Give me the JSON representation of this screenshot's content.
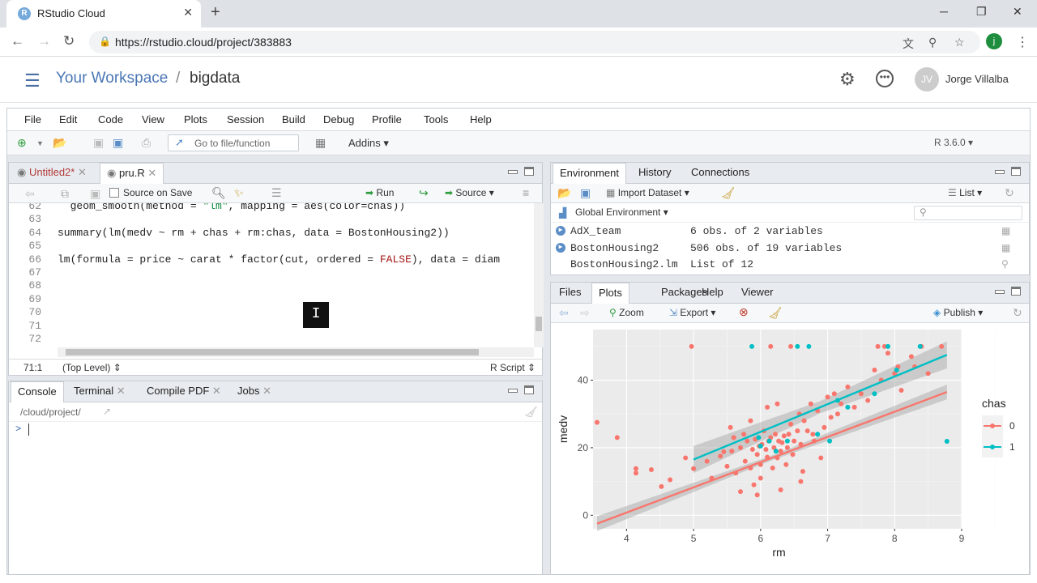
{
  "browser": {
    "tab_title": "RStudio Cloud",
    "tab_favicon": "R",
    "url": "https://rstudio.cloud/project/383883",
    "profile_initial": "j"
  },
  "header": {
    "workspace": "Your Workspace",
    "separator": "/",
    "project": "bigdata",
    "avatar_initials": "JV",
    "username": "Jorge Villalba"
  },
  "menubar": [
    "File",
    "Edit",
    "Code",
    "View",
    "Plots",
    "Session",
    "Build",
    "Debug",
    "Profile",
    "Tools",
    "Help"
  ],
  "toolbar": {
    "goto_placeholder": "Go to file/function",
    "addins": "Addins",
    "r_version": "R 3.6.0"
  },
  "editor": {
    "tabs": [
      "Untitled2*",
      "pru.R"
    ],
    "source_on_save": "Source on Save",
    "run": "Run",
    "source": "Source",
    "lines": [
      {
        "n": "62",
        "code": "  geom_smooth(method = \"lm\", mapping = aes(color=chas))"
      },
      {
        "n": "63",
        "code": ""
      },
      {
        "n": "64",
        "code": "summary(lm(medv ~ rm + chas + rm:chas, data = BostonHousing2))"
      },
      {
        "n": "65",
        "code": ""
      },
      {
        "n": "66",
        "code": "lm(formula = price ~ carat * factor(cut, ordered = FALSE), data = diam"
      },
      {
        "n": "67",
        "code": ""
      },
      {
        "n": "68",
        "code": ""
      },
      {
        "n": "69",
        "code": ""
      },
      {
        "n": "70",
        "code": ""
      },
      {
        "n": "71",
        "code": ""
      },
      {
        "n": "72",
        "code": ""
      }
    ],
    "status_pos": "71:1",
    "status_scope": "(Top Level)",
    "status_type": "R Script"
  },
  "console": {
    "tabs": [
      "Console",
      "Terminal",
      "Compile PDF",
      "Jobs"
    ],
    "path": "/cloud/project/",
    "prompt": ">"
  },
  "environment": {
    "tabs": [
      "Environment",
      "History",
      "Connections"
    ],
    "import_dataset": "Import Dataset",
    "list_label": "List",
    "scope": "Global Environment",
    "rows": [
      {
        "name": "AdX_team",
        "value": "6 obs. of 2 variables"
      },
      {
        "name": "BostonHousing2",
        "value": "506 obs. of 19 variables"
      },
      {
        "name": "BostonHousing2.lm",
        "value": "List of 12"
      }
    ]
  },
  "plots": {
    "tabs": [
      "Files",
      "Plots",
      "Packages",
      "Help",
      "Viewer"
    ],
    "zoom": "Zoom",
    "export": "Export",
    "publish": "Publish"
  },
  "chart_data": {
    "type": "scatter",
    "title": "",
    "xlabel": "rm",
    "ylabel": "medv",
    "xlim": [
      3.5,
      9
    ],
    "ylim": [
      -4,
      55
    ],
    "xticks": [
      "4",
      "5",
      "6",
      "7",
      "8",
      "9"
    ],
    "yticks": [
      "0",
      "20",
      "40"
    ],
    "legend_title": "chas",
    "legend_position": "right",
    "series": [
      {
        "name": "0",
        "color": "#f8766d",
        "points": [
          [
            3.56,
            27.5
          ],
          [
            3.86,
            23
          ],
          [
            4.14,
            13.8
          ],
          [
            4.14,
            12.5
          ],
          [
            4.37,
            13.5
          ],
          [
            4.52,
            8.5
          ],
          [
            4.65,
            10.5
          ],
          [
            4.88,
            17
          ],
          [
            4.97,
            50
          ],
          [
            5.0,
            13.8
          ],
          [
            5.2,
            16
          ],
          [
            5.27,
            11
          ],
          [
            5.4,
            17.5
          ],
          [
            5.45,
            18.8
          ],
          [
            5.5,
            14.5
          ],
          [
            5.57,
            19
          ],
          [
            5.6,
            23
          ],
          [
            5.63,
            12.5
          ],
          [
            5.7,
            20
          ],
          [
            5.75,
            24
          ],
          [
            5.77,
            16
          ],
          [
            5.8,
            22
          ],
          [
            5.85,
            14
          ],
          [
            5.88,
            19.5
          ],
          [
            5.9,
            9
          ],
          [
            5.92,
            22.5
          ],
          [
            5.95,
            18
          ],
          [
            5.98,
            20.5
          ],
          [
            6.0,
            15
          ],
          [
            6.02,
            21
          ],
          [
            6.05,
            25
          ],
          [
            6.08,
            19.5
          ],
          [
            6.1,
            17.2
          ],
          [
            6.12,
            22
          ],
          [
            6.15,
            23
          ],
          [
            6.18,
            14
          ],
          [
            6.2,
            20
          ],
          [
            6.22,
            24
          ],
          [
            6.25,
            17
          ],
          [
            6.27,
            22
          ],
          [
            6.3,
            19
          ],
          [
            6.32,
            21.5
          ],
          [
            6.35,
            23.5
          ],
          [
            6.38,
            15
          ],
          [
            6.4,
            20
          ],
          [
            6.42,
            24
          ],
          [
            6.45,
            27
          ],
          [
            6.48,
            18
          ],
          [
            6.5,
            22
          ],
          [
            6.55,
            25
          ],
          [
            6.58,
            30
          ],
          [
            6.6,
            21
          ],
          [
            6.63,
            13
          ],
          [
            6.65,
            28
          ],
          [
            6.7,
            25
          ],
          [
            6.75,
            33
          ],
          [
            6.78,
            24
          ],
          [
            6.8,
            22
          ],
          [
            6.85,
            31
          ],
          [
            6.9,
            17
          ],
          [
            6.95,
            26
          ],
          [
            7.0,
            35
          ],
          [
            7.05,
            29
          ],
          [
            7.1,
            36
          ],
          [
            7.15,
            30
          ],
          [
            7.2,
            33
          ],
          [
            7.3,
            38
          ],
          [
            7.4,
            32
          ],
          [
            7.5,
            36
          ],
          [
            7.6,
            34
          ],
          [
            7.7,
            43
          ],
          [
            7.8,
            40
          ],
          [
            7.85,
            50
          ],
          [
            7.9,
            48
          ],
          [
            8.0,
            42
          ],
          [
            8.05,
            44
          ],
          [
            8.1,
            37
          ],
          [
            8.25,
            47
          ],
          [
            8.3,
            44
          ],
          [
            8.4,
            50
          ],
          [
            8.5,
            42
          ],
          [
            8.7,
            50
          ],
          [
            6.15,
            50
          ],
          [
            6.45,
            50
          ],
          [
            7.75,
            50
          ],
          [
            6.1,
            32
          ],
          [
            5.55,
            26
          ],
          [
            6.0,
            11
          ],
          [
            6.6,
            10
          ],
          [
            5.7,
            7
          ],
          [
            5.95,
            6
          ],
          [
            6.3,
            7.5
          ],
          [
            5.85,
            28
          ],
          [
            6.25,
            33
          ]
        ]
      },
      {
        "name": "1",
        "color": "#00bfc4",
        "points": [
          [
            5.87,
            50
          ],
          [
            5.97,
            23
          ],
          [
            6.0,
            20.5
          ],
          [
            6.13,
            22
          ],
          [
            6.23,
            19
          ],
          [
            6.4,
            22
          ],
          [
            6.55,
            50
          ],
          [
            6.72,
            50
          ],
          [
            6.85,
            24
          ],
          [
            7.03,
            22
          ],
          [
            7.15,
            34
          ],
          [
            7.3,
            32
          ],
          [
            7.7,
            36
          ],
          [
            7.9,
            50
          ],
          [
            8.03,
            43
          ],
          [
            8.38,
            50
          ],
          [
            8.78,
            21.9
          ]
        ]
      }
    ],
    "fits": [
      {
        "series": "0",
        "x": [
          3.56,
          8.78
        ],
        "y": [
          -2.5,
          36.5
        ]
      },
      {
        "series": "1",
        "x": [
          5.0,
          8.78
        ],
        "y": [
          16.5,
          47.5
        ]
      }
    ]
  }
}
